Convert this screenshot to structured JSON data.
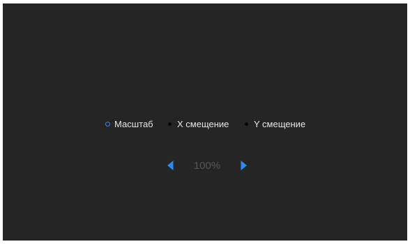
{
  "options": [
    {
      "label": "Масштаб",
      "selected": true
    },
    {
      "label": "X смещение",
      "selected": false
    },
    {
      "label": "Y смещение",
      "selected": false
    }
  ],
  "stepper": {
    "value": "100%",
    "prev_icon": "chevron-left-icon",
    "next_icon": "chevron-right-icon"
  },
  "colors": {
    "background": "#252525",
    "accent": "#2a8cf0",
    "text": "#e6e6e6",
    "value_text": "#555555"
  }
}
